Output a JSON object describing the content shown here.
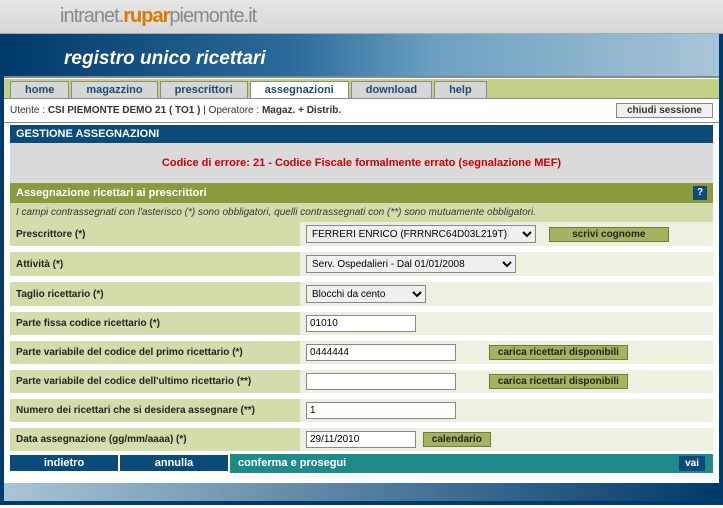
{
  "banner": {
    "p1": "intranet.",
    "p2": "rupar",
    "p3": "piemonte.it"
  },
  "title": "registro unico ricettari",
  "tabs": {
    "home": "home",
    "magazzino": "magazzino",
    "prescrittori": "prescrittori",
    "assegnazioni": "assegnazioni",
    "download": "download",
    "help": "help"
  },
  "userbar": {
    "utente_label": "Utente : ",
    "utente": "CSI PIEMONTE DEMO 21 ( TO1 )",
    "op_label": " | Operatore : ",
    "operatore": "Magaz. + Distrib.",
    "chiudi": "chiudi sessione"
  },
  "section_title": "GESTIONE ASSEGNAZIONI",
  "error": "Codice di errore: 21 - Codice Fiscale formalmente errato (segnalazione MEF)",
  "green_bar": "Assegnazione ricettari ai prescrittori",
  "help_icon": "?",
  "mandatory_note": "I campi contrassegnati con l'asterisco (*) sono obbligatori, quelli contrassegnati con (**) sono mutuamente obbligatori.",
  "labels": {
    "prescrittore": "Prescrittore (*)",
    "attivita": "Attività (*)",
    "taglio": "Taglio ricettario (*)",
    "parte_fissa": "Parte fissa codice ricettario (*)",
    "parte_var_primo": "Parte variabile del codice del primo ricettario (*)",
    "parte_var_ultimo": "Parte variabile del codice dell'ultimo ricettario (**)",
    "numero": "Numero dei ricettari che si desidera assegnare (**)",
    "data": "Data assegnazione (gg/mm/aaaa) (*)"
  },
  "values": {
    "prescrittore": "FERRERI ENRICO (FRRNRC64D03L219T)",
    "attivita": "Serv. Ospedalieri - Dal 01/01/2008",
    "taglio": "Blocchi da cento",
    "parte_fissa": "01010",
    "parte_var_primo": "0444444",
    "parte_var_ultimo": "",
    "numero": "1",
    "data": "29/11/2010"
  },
  "buttons": {
    "scrivi_cognome": "scrivi cognome",
    "carica": "carica ricettari disponibili",
    "calendario": "calendario",
    "indietro": "indietro",
    "annulla": "annulla",
    "conferma": "conferma e prosegui",
    "vai": "vai"
  }
}
